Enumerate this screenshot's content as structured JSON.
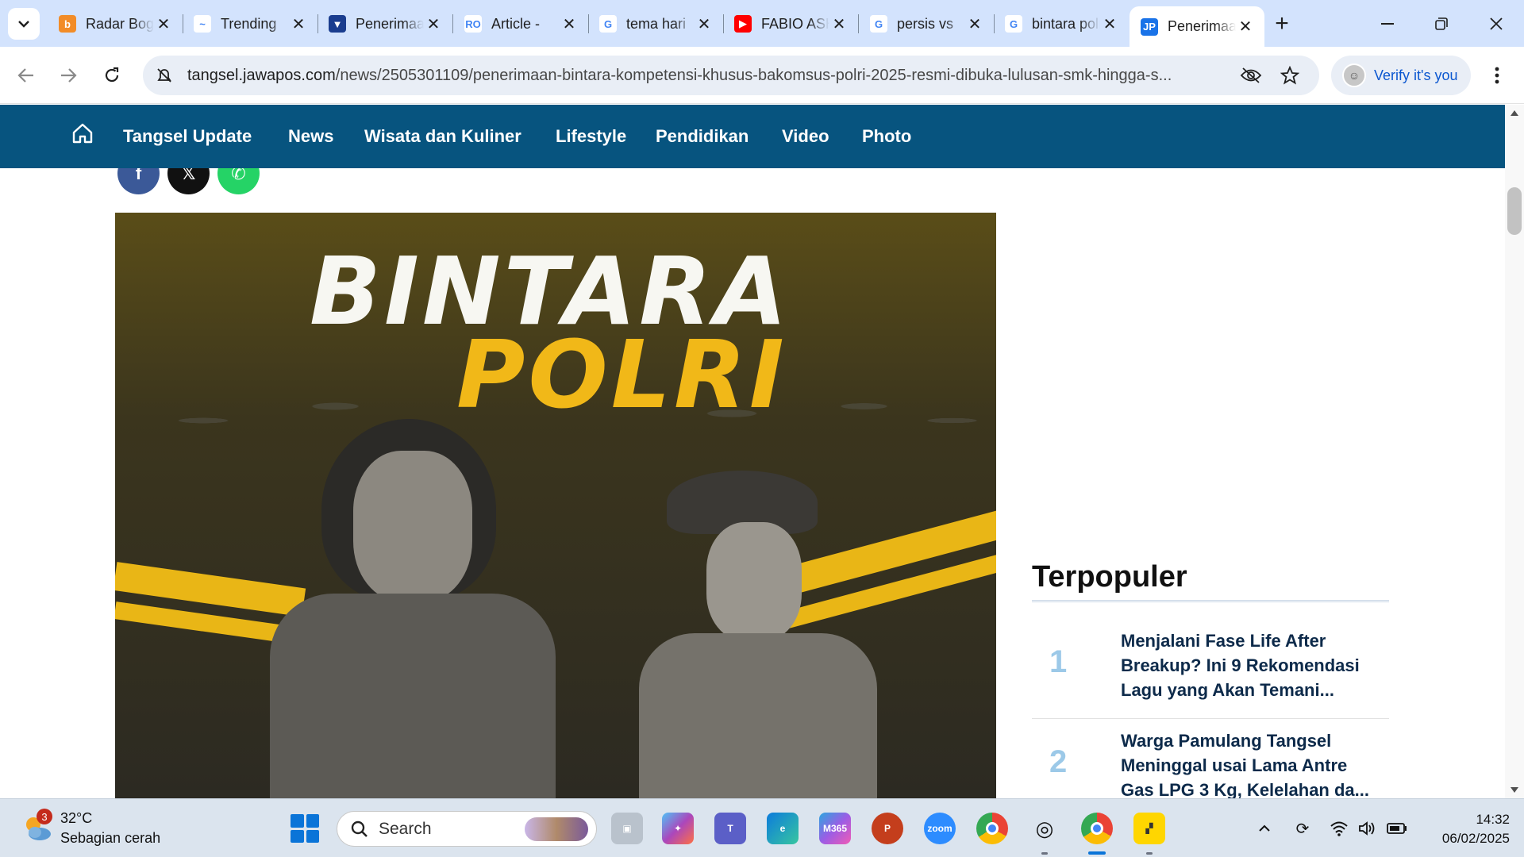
{
  "browser": {
    "tabs": [
      {
        "title": "Radar Bogor",
        "fav_color": "#f28c28",
        "fav_glyph": "b"
      },
      {
        "title": "Trending",
        "fav_color": "#ffffff",
        "fav_glyph": "~"
      },
      {
        "title": "Penerimaan",
        "fav_color": "#1a3d8f",
        "fav_glyph": "▼"
      },
      {
        "title": "Article - ",
        "fav_color": "#ffffff",
        "fav_glyph": "RO"
      },
      {
        "title": "tema hari",
        "fav_color": "#ffffff",
        "fav_glyph": "G"
      },
      {
        "title": "FABIO ASHER",
        "fav_color": "#ff0000",
        "fav_glyph": "▶"
      },
      {
        "title": "persis vs",
        "fav_color": "#ffffff",
        "fav_glyph": "G"
      },
      {
        "title": "bintara polri",
        "fav_color": "#ffffff",
        "fav_glyph": "G"
      },
      {
        "title": "Penerimaan",
        "fav_color": "#1a73e8",
        "fav_glyph": "JP",
        "active": true
      }
    ],
    "url_domain": "tangsel.jawapos.com",
    "url_path": "/news/2505301109/penerimaan-bintara-kompetensi-khusus-bakomsus-polri-2025-resmi-dibuka-lulusan-smk-hingga-s...",
    "verify_label": "Verify it's you"
  },
  "site": {
    "nav": [
      "Tangsel Update",
      "News",
      "Wisata dan Kuliner",
      "Lifestyle",
      "Pendidikan",
      "Video",
      "Photo"
    ],
    "share": [
      {
        "name": "facebook",
        "color": "#3b5998",
        "glyph": "f"
      },
      {
        "name": "x",
        "color": "#111111",
        "glyph": "𝕏"
      },
      {
        "name": "whatsapp",
        "color": "#25d366",
        "glyph": "✆"
      }
    ],
    "hero": {
      "line1": "BINTARA",
      "line2": "POLRI"
    },
    "sidebar": {
      "title": "Terpopuler",
      "items": [
        {
          "rank": "1",
          "text": "Menjalani Fase Life After Breakup? Ini 9 Rekomendasi Lagu yang Akan Temani..."
        },
        {
          "rank": "2",
          "text": "Warga Pamulang Tangsel Meninggal usai Lama Antre Gas LPG 3 Kg, Kelelahan da..."
        }
      ]
    }
  },
  "taskbar": {
    "weather_temp": "32°C",
    "weather_desc": "Sebagian cerah",
    "weather_badge": "3",
    "search_label": "Search",
    "time": "14:32",
    "date": "06/02/2025"
  }
}
